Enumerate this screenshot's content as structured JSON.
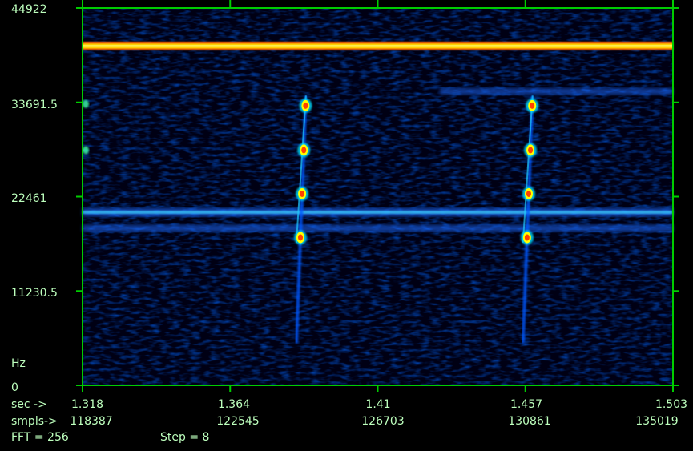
{
  "chart_data": {
    "type": "heatmap",
    "ylabel": "Hz",
    "y_ticks": [
      "44922",
      "33691.5",
      "22461",
      "11230.5",
      "0"
    ],
    "ylim": [
      0,
      44922
    ],
    "x_axis_sec": {
      "label": "sec ->",
      "ticks": [
        "1.318",
        "1.364",
        "1.41",
        "1.457",
        "1.503"
      ]
    },
    "x_axis_samples": {
      "label": "smpls->",
      "ticks": [
        "118387",
        "122545",
        "126703",
        "130861",
        "135019"
      ]
    },
    "xlim_sec": [
      1.318,
      1.503
    ],
    "grid": true,
    "bands_hz": [
      {
        "freq": 40400,
        "strength": 1.0,
        "kind": "constant-tone"
      },
      {
        "freq": 20600,
        "strength": 0.55,
        "kind": "constant-band"
      },
      {
        "freq": 18700,
        "strength": 0.35,
        "kind": "constant-band"
      },
      {
        "freq": 35000,
        "strength": 0.3,
        "kind": "partial-band",
        "from_sec": 1.43
      }
    ],
    "pulses": [
      {
        "sec_start": 1.385,
        "sec_end": 1.388,
        "freq_low": 5000,
        "freq_high": 34500,
        "hotspots_hz": [
          33300,
          28000,
          22800,
          17600
        ]
      },
      {
        "sec_start": 1.456,
        "sec_end": 1.459,
        "freq_low": 5000,
        "freq_high": 34500,
        "hotspots_hz": [
          33300,
          28000,
          22800,
          17600
        ]
      }
    ],
    "edge_spots": [
      {
        "sec": 1.3185,
        "freq": 33500
      },
      {
        "sec": 1.3185,
        "freq": 28000
      }
    ]
  },
  "footer": {
    "fft": "FFT = 256",
    "step": "Step = 8"
  },
  "colors": {
    "axis": "#00cc00",
    "text": "#bdffbd",
    "background": "#000000",
    "colormap": [
      "#000010",
      "#0010a0",
      "#0044ff",
      "#00e0ff",
      "#ffff00",
      "#ff8000",
      "#ff0000"
    ]
  }
}
